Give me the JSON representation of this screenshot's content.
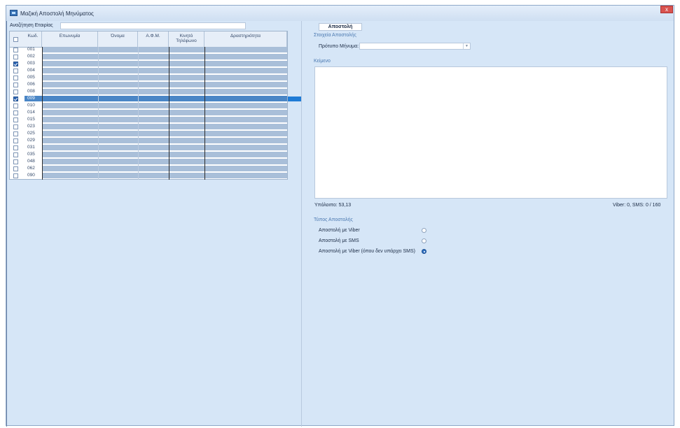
{
  "window": {
    "title": "Μαζική Αποστολή Μηνύματος",
    "close_label": "x"
  },
  "search": {
    "label": "Αναζήτηση Εταιρίας",
    "value": ""
  },
  "grid": {
    "headers": [
      "Κωδ.",
      "Επωνυμία",
      "Όνομα",
      "Α.Φ.Μ.",
      "Κινητό Τηλέφωνο",
      "Δραστηριότητα"
    ],
    "rows": [
      {
        "code": "001",
        "checked": false
      },
      {
        "code": "002",
        "checked": false
      },
      {
        "code": "003",
        "checked": true
      },
      {
        "code": "004",
        "checked": false
      },
      {
        "code": "005",
        "checked": false
      },
      {
        "code": "006",
        "checked": false
      },
      {
        "code": "008",
        "checked": false
      },
      {
        "code": "009",
        "checked": true,
        "selected": true
      },
      {
        "code": "010",
        "checked": false
      },
      {
        "code": "014",
        "checked": false
      },
      {
        "code": "015",
        "checked": false
      },
      {
        "code": "023",
        "checked": false
      },
      {
        "code": "025",
        "checked": false
      },
      {
        "code": "029",
        "checked": false
      },
      {
        "code": "031",
        "checked": false
      },
      {
        "code": "035",
        "checked": false
      },
      {
        "code": "048",
        "checked": false
      },
      {
        "code": "062",
        "checked": false
      },
      {
        "code": "090",
        "checked": false
      }
    ]
  },
  "send_button": "Αποστολή",
  "send_details": {
    "section_label": "Στοιχεία Αποστολής",
    "template_label": "Πρότυπο Μήνυμα:",
    "template_value": "",
    "text_label": "Κείμενο",
    "text_value": "",
    "balance": "Υπόλοιπο:  53,13",
    "counter": "Viber: 0,  SMS: 0 / 160"
  },
  "send_type": {
    "section_label": "Τύπος Αποστολής",
    "options": [
      {
        "label": "Αποστολή με Viber",
        "selected": false
      },
      {
        "label": "Αποστολή με SMS",
        "selected": false
      },
      {
        "label": "Αποστολή με Viber (όπου δεν υπάρχει SMS)",
        "selected": true
      }
    ]
  }
}
